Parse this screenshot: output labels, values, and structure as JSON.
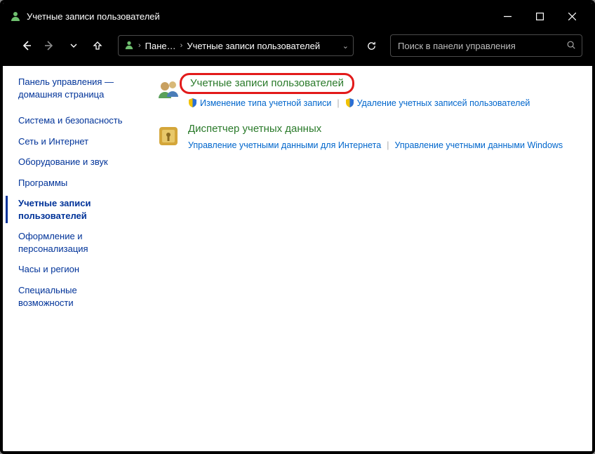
{
  "window": {
    "title": "Учетные записи пользователей"
  },
  "breadcrumb": {
    "root": "Пане…",
    "current": "Учетные записи пользователей"
  },
  "search": {
    "placeholder": "Поиск в панели управления"
  },
  "sidebar": {
    "home": "Панель управления — домашняя страница",
    "items": [
      "Система и безопасность",
      "Сеть и Интернет",
      "Оборудование и звук",
      "Программы",
      "Учетные записи пользователей",
      "Оформление и персонализация",
      "Часы и регион",
      "Специальные возможности"
    ]
  },
  "content": {
    "blocks": [
      {
        "title": "Учетные записи пользователей",
        "links": [
          "Изменение типа учетной записи",
          "Удаление учетных записей пользователей"
        ]
      },
      {
        "title": "Диспетчер учетных данных",
        "links": [
          "Управление учетными данными для Интернета",
          "Управление учетными данными Windows"
        ]
      }
    ]
  }
}
